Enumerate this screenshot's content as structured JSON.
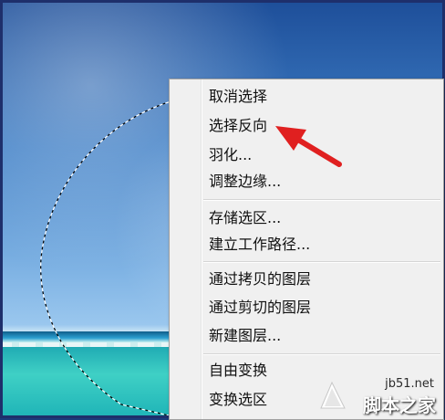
{
  "menu": {
    "items": [
      {
        "label": "取消选择"
      },
      {
        "label": "选择反向"
      },
      {
        "label": "羽化..."
      },
      {
        "label": "调整边缘..."
      },
      {
        "label": "存储选区..."
      },
      {
        "label": "建立工作路径..."
      },
      {
        "label": "通过拷贝的图层"
      },
      {
        "label": "通过剪切的图层"
      },
      {
        "label": "新建图层..."
      },
      {
        "label": "自由变换"
      },
      {
        "label": "变换选区"
      }
    ]
  },
  "watermark": {
    "site": "jb51.net",
    "name": "脚本之家"
  },
  "colors": {
    "arrow": "#e02020",
    "menu_bg": "#f0f0f0",
    "frame": "#1e2f6b"
  }
}
